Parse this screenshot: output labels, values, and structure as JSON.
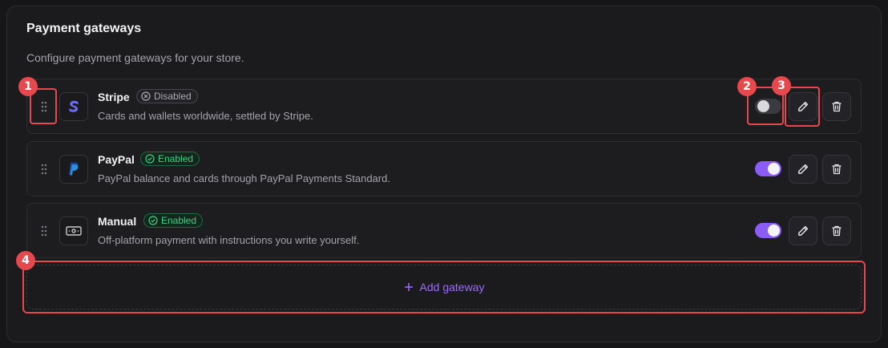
{
  "section": {
    "title": "Payment gateways",
    "subtitle": "Configure payment gateways for your store."
  },
  "gateways": [
    {
      "name": "Stripe",
      "status": "Disabled",
      "description": "Cards and wallets worldwide, settled by Stripe.",
      "enabled": false,
      "logo_icon": "stripe-logo-icon"
    },
    {
      "name": "PayPal",
      "status": "Enabled",
      "description": "PayPal balance and cards through PayPal Payments Standard.",
      "enabled": true,
      "logo_icon": "paypal-logo-icon"
    },
    {
      "name": "Manual",
      "status": "Enabled",
      "description": "Off-platform payment with instructions you write yourself.",
      "enabled": true,
      "logo_icon": "cash-icon"
    }
  ],
  "add_button": {
    "label": "Add gateway",
    "icon": "plus-icon"
  },
  "annotations": [
    "1",
    "2",
    "3",
    "4"
  ],
  "colors": {
    "accent": "#8b5cf6",
    "enabled": "#3fcf82",
    "highlight": "#e5484d"
  }
}
